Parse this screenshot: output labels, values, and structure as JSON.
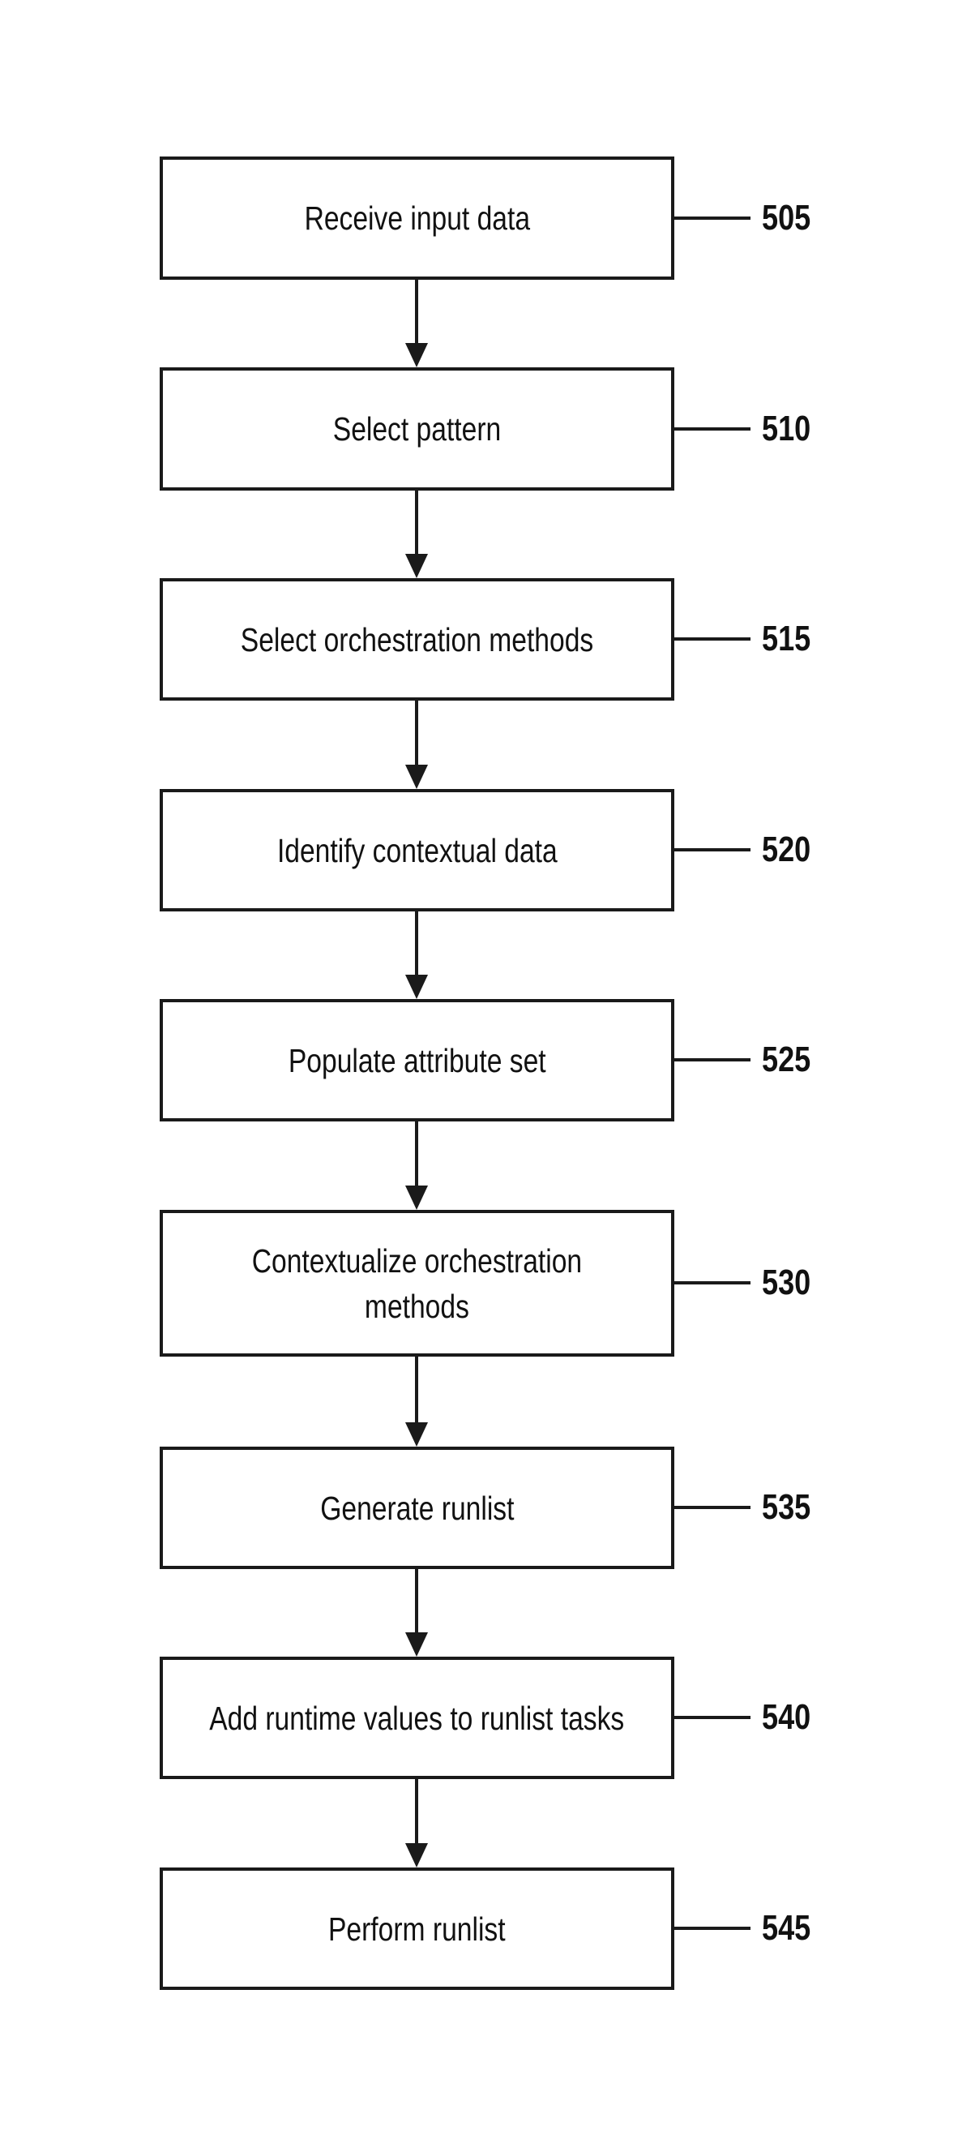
{
  "diagram": {
    "type": "flowchart",
    "direction": "top-to-bottom",
    "steps": [
      {
        "text": "Receive input data",
        "ref": "505"
      },
      {
        "text": "Select pattern",
        "ref": "510"
      },
      {
        "text": "Select orchestration methods",
        "ref": "515"
      },
      {
        "text": "Identify contextual data",
        "ref": "520"
      },
      {
        "text": "Populate attribute set",
        "ref": "525"
      },
      {
        "text": "Contextualize orchestration\nmethods",
        "ref": "530"
      },
      {
        "text": "Generate runlist",
        "ref": "535"
      },
      {
        "text": "Add runtime values to runlist tasks",
        "ref": "540"
      },
      {
        "text": "Perform runlist",
        "ref": "545"
      }
    ],
    "connections": [
      {
        "from": "505",
        "to": "510"
      },
      {
        "from": "510",
        "to": "515"
      },
      {
        "from": "515",
        "to": "520"
      },
      {
        "from": "520",
        "to": "525"
      },
      {
        "from": "525",
        "to": "530"
      },
      {
        "from": "530",
        "to": "535"
      },
      {
        "from": "535",
        "to": "540"
      },
      {
        "from": "540",
        "to": "545"
      }
    ],
    "colors": {
      "stroke": "#1a1a1a",
      "background": "#ffffff",
      "text": "#111111"
    }
  }
}
